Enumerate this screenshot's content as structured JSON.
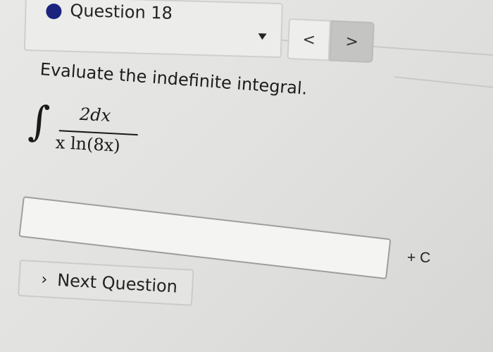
{
  "header": {
    "question_title": "Question 18",
    "status_dot_color": "#1a237e",
    "dropdown_icon": "caret-down-icon",
    "prev_label": "<",
    "next_label": ">"
  },
  "prompt": "Evaluate the indefinite integral.",
  "integral": {
    "sign": "∫",
    "numerator": "2dx",
    "denominator": "x ln(8x)"
  },
  "answer": {
    "value": "",
    "suffix": "+ C"
  },
  "footer": {
    "next_question_icon": "chevron-right-icon",
    "next_question_chevron": "›",
    "next_question_label": "Next Question"
  }
}
